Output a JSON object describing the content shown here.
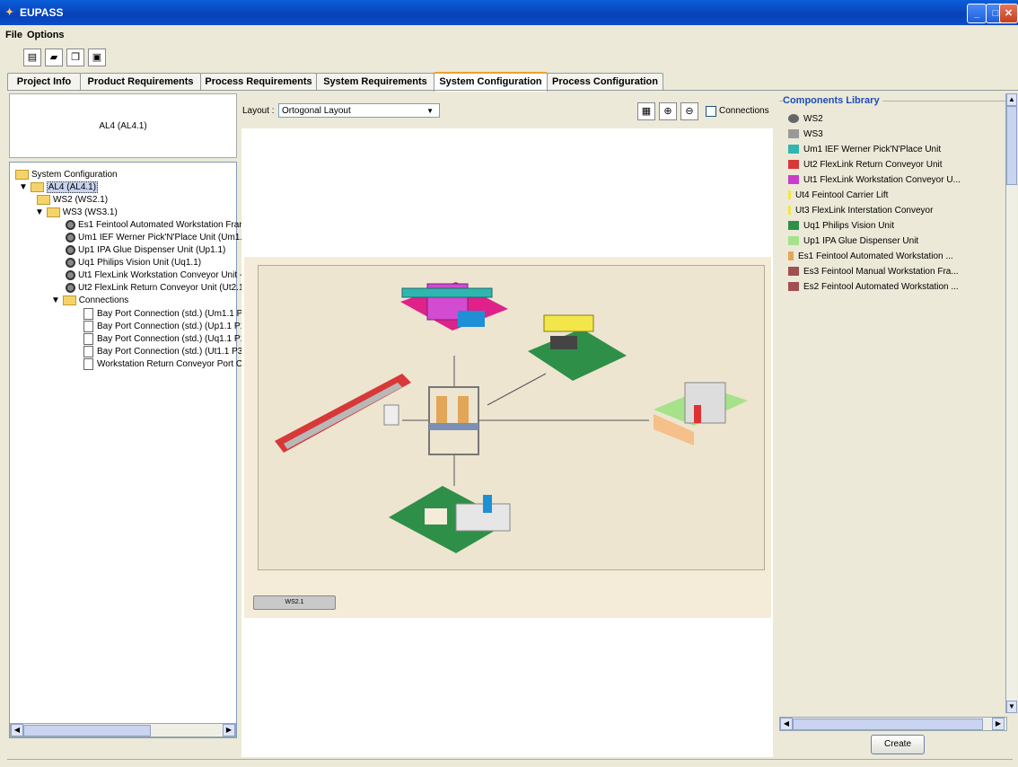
{
  "window": {
    "title": "EUPASS"
  },
  "menu": [
    "File",
    "Options"
  ],
  "tabs": [
    "Project Info",
    "Product Requirements",
    "Process Requirements",
    "System Requirements",
    "System Configuration",
    "Process Configuration"
  ],
  "active_tab": "System Configuration",
  "header_label": "AL4 (AL4.1)",
  "tree": {
    "root": "System Configuration",
    "items": [
      "AL4 (AL4.1)",
      "WS2 (WS2.1)",
      "WS3 (WS3.1)",
      "Es1 Feintool Automated Workstation Fran",
      "Um1 IEF Werner Pick'N'Place Unit (Um1.1",
      "Up1 IPA Glue Dispenser Unit (Up1.1)",
      "Uq1 Philips Vision Unit (Uq1.1)",
      "Ut1 FlexLink Workstation Conveyor Unit -",
      "Ut2 FlexLink Return Conveyor Unit (Ut2.1",
      "Connections",
      "Bay Port Connection (std.) (Um1.1 P1",
      "Bay Port Connection (std.) (Up1.1 P1",
      "Bay Port Connection (std.) (Uq1.1 P1",
      "Bay Port Connection (std.) (Ut1.1 P3",
      "Workstation Return Conveyor Port C"
    ]
  },
  "layout": {
    "label": "Layout :",
    "selected": "Ortogonal Layout",
    "connections_label": "Connections"
  },
  "canvas": {
    "ws_label": "WS2.1"
  },
  "library": {
    "title": "Components Library",
    "items": [
      "WS2",
      "WS3",
      "Um1 IEF Werner Pick'N'Place Unit",
      "Ut2 FlexLink Return Conveyor Unit",
      "Ut1 FlexLink Workstation Conveyor U...",
      "Ut4 Feintool Carrier Lift",
      "Ut3 FlexLink Interstation Conveyor",
      "Uq1 Philips Vision Unit",
      "Up1 IPA Glue Dispenser Unit",
      "Es1 Feintool Automated Workstation ...",
      "Es3 Feintool Manual Workstation Fra...",
      "Es2 Feintool Automated Workstation ..."
    ],
    "create_label": "Create"
  }
}
